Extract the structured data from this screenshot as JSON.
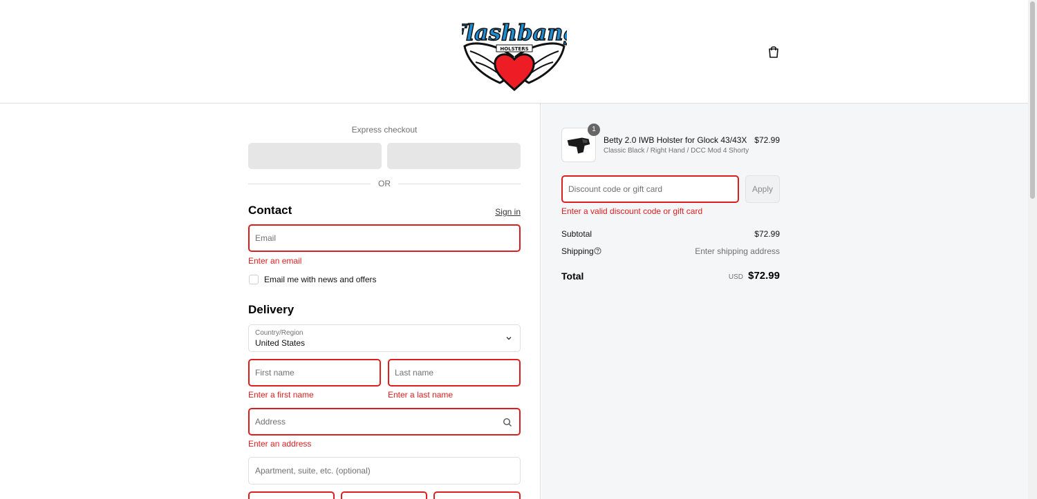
{
  "brand": {
    "logo_text": "Flashbang",
    "logo_subtext": "HOLSTERS"
  },
  "icons": {
    "cart": "shopping-bag-icon",
    "chevron": "chevron-down-icon",
    "search": "search-icon",
    "help": "question-circle-icon"
  },
  "colors": {
    "error": "#dd1d1d",
    "summary_bg": "#f5f6f8",
    "logo_blue": "#1f8ccf",
    "logo_heart": "#ee1c25"
  },
  "express": {
    "label": "Express checkout",
    "divider": "OR"
  },
  "contact": {
    "heading": "Contact",
    "sign_in": "Sign in",
    "email_placeholder": "Email",
    "email_error": "Enter an email",
    "newsletter_label": "Email me with news and offers"
  },
  "delivery": {
    "heading": "Delivery",
    "country_label": "Country/Region",
    "country_value": "United States",
    "first_name_placeholder": "First name",
    "first_name_error": "Enter a first name",
    "last_name_placeholder": "Last name",
    "last_name_error": "Enter a last name",
    "address_placeholder": "Address",
    "address_error": "Enter an address",
    "apartment_placeholder": "Apartment, suite, etc. (optional)"
  },
  "summary": {
    "item": {
      "quantity": "1",
      "name": "Betty 2.0 IWB Holster for Glock 43/43X",
      "variant": "Classic Black / Right Hand / DCC Mod 4 Shorty",
      "price": "$72.99"
    },
    "discount_placeholder": "Discount code or gift card",
    "discount_error": "Enter a valid discount code or gift card",
    "apply_label": "Apply",
    "subtotal_label": "Subtotal",
    "subtotal_value": "$72.99",
    "shipping_label": "Shipping",
    "shipping_value": "Enter shipping address",
    "total_label": "Total",
    "currency": "USD",
    "total_value": "$72.99"
  }
}
